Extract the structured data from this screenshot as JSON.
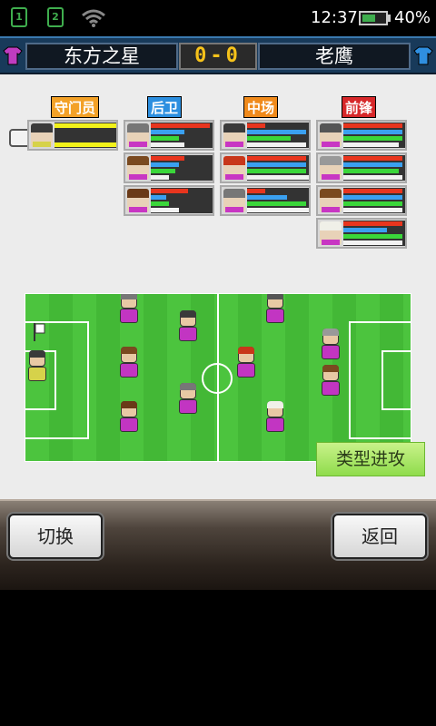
{
  "status_bar": {
    "sim1": "1",
    "sim2": "2",
    "time": "12:37",
    "battery_percent": "40%",
    "battery_level": 0.6
  },
  "scoreboard": {
    "home_team": "东方之星",
    "score": "0-0",
    "away_team": "老鹰",
    "home_shirt_color": "#c03cc0",
    "away_shirt_color": "#2f8fe0"
  },
  "positions": {
    "gk": "守门员",
    "df": "后卫",
    "mf": "中场",
    "fw": "前锋"
  },
  "cards": {
    "gk": [
      {
        "hair": "#3a3a3a",
        "bars": [
          1.0,
          0.0,
          0.0,
          1.0
        ],
        "gk": true
      }
    ],
    "df": [
      {
        "hair": "#777",
        "bars": [
          0.95,
          0.55,
          0.45,
          0.55
        ]
      },
      {
        "hair": "#7a4a20",
        "bars": [
          0.55,
          0.45,
          0.4,
          0.3
        ]
      },
      {
        "hair": "#6a3a18",
        "bars": [
          0.6,
          0.25,
          0.3,
          0.45
        ]
      }
    ],
    "mf": [
      {
        "hair": "#3a3a3a",
        "bars": [
          0.3,
          0.95,
          0.7,
          0.95
        ]
      },
      {
        "hair": "#c8371a",
        "bars": [
          0.95,
          0.95,
          0.95,
          1.0
        ]
      },
      {
        "hair": "#777",
        "bars": [
          0.3,
          0.65,
          0.95,
          1.0
        ]
      }
    ],
    "fw": [
      {
        "hair": "#555",
        "bars": [
          0.95,
          0.95,
          0.95,
          0.9
        ]
      },
      {
        "hair": "#999",
        "bars": [
          0.95,
          0.95,
          0.9,
          0.95
        ]
      },
      {
        "hair": "#7a4a20",
        "bars": [
          0.95,
          0.95,
          0.95,
          0.95
        ]
      },
      {
        "hair": "#f0f0e8",
        "bars": [
          0.95,
          0.7,
          0.95,
          0.95
        ]
      }
    ]
  },
  "bar_colors": [
    "#e8351e",
    "#3aa0f0",
    "#3ad63a",
    "#f2f2f2"
  ],
  "gk_bar_color": "#f2f21a",
  "tactic_button": "类型进攻",
  "buttons": {
    "switch": "切换",
    "back": "返回"
  },
  "icons": {
    "sim1": "sim-card-1-icon",
    "sim2": "sim-card-2-icon",
    "wifi": "wifi-icon",
    "battery": "battery-icon",
    "home_shirt": "home-shirt-icon",
    "away_shirt": "away-shirt-icon",
    "pointer": "pointing-hand-icon",
    "captain_flag": "captain-flag-icon"
  }
}
